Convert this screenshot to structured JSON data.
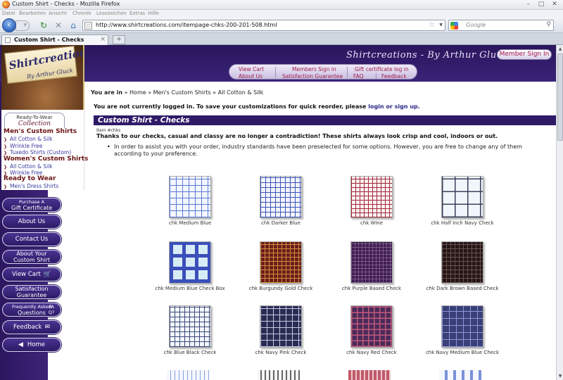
{
  "window": {
    "title": "Custom Shirt - Checks - Mozilla Firefox",
    "controls": [
      "–",
      "□",
      "✕"
    ]
  },
  "menubar": [
    "Datei",
    "Bearbeiten",
    "Ansicht",
    "Chronik",
    "Lesezeichen",
    "Extras",
    "Hilfe"
  ],
  "navbar": {
    "url": "http://www.shirtcreations.com/itempage-chks-200-201-508.html",
    "search_placeholder": "Google"
  },
  "tab": {
    "title": "Custom Shirt - Checks"
  },
  "header": {
    "brand": "Shirtcreations - By Arthur Gluck",
    "signin": "Member Sign In",
    "logo_main": "Shirtcreations",
    "logo_sub": "By Arthur Gluck"
  },
  "topmenu": {
    "row1": [
      "View Cart",
      "Members Sign in",
      "Gift certificate log in"
    ],
    "row2": [
      "About Us",
      "Satisfaction Guarantee",
      "FAQ",
      "Feedback"
    ]
  },
  "sidebar": {
    "rtw_line1": "Ready-To-Wear",
    "rtw_line2": "Collection",
    "sections": [
      {
        "heading": "Men's Custom Shirts",
        "links": [
          "All Cotton & Silk",
          "Wrinkle Free",
          "Tuxedo Shirts (Custom)"
        ]
      },
      {
        "heading": "Women's Custom Shirts",
        "links": [
          "All Cotton & Silk",
          "Wrinkle Free"
        ]
      },
      {
        "heading": "Ready to Wear",
        "links": [
          "Men's Dress Shirts"
        ]
      }
    ],
    "buttons": [
      {
        "l1": "Purchase A",
        "l2": "Gift Certificate"
      },
      {
        "label": "About Us"
      },
      {
        "label": "Contact Us"
      },
      {
        "l1": "About Your",
        "l2": "Custom Shirt"
      },
      {
        "label": "View Cart"
      },
      {
        "l1": "Satisfaction",
        "l2": "Guarantee"
      },
      {
        "l1": "Frequently Asked",
        "l2": "Questions"
      },
      {
        "label": "Feedback"
      },
      {
        "label": "Home"
      }
    ],
    "faq_badge": "FA Q?"
  },
  "breadcrumb": {
    "you": "You are in",
    "sep": "»",
    "items": [
      "Home",
      "Men's Custom Shirts",
      "All Cotton & Silk"
    ]
  },
  "login_msg": {
    "text": "You are not currently logged in. To save your customizations for quick reorder, please",
    "link": "login or sign up."
  },
  "page": {
    "title": "Custom Shirt - Checks",
    "item_no": "Item #chks",
    "intro": "Thanks to our checks, casual and classy are no longer a contradiction! These shirts always look crisp and cool, indoors or out.",
    "note": "In order to assist you with your order, industry standards have been preselected for some options. However, you are free to change any of them according to your preference."
  },
  "products": [
    {
      "name": "chk Medium Blue",
      "base": "#f4f7ff",
      "line": "#5a78d8",
      "grid": 9,
      "width": 1
    },
    {
      "name": "chk Darker Blue",
      "base": "#f2f4fb",
      "line": "#3b55b8",
      "grid": 7,
      "width": 1
    },
    {
      "name": "chk Wine",
      "base": "#fbf2f2",
      "line": "#a2283a",
      "grid": 6,
      "width": 1
    },
    {
      "name": "chk Half Inch Navy Check",
      "base": "#f0f6fb",
      "line": "#3a4058",
      "grid": 18,
      "width": 1.5
    },
    {
      "name": "chk Medium Blue Check Box",
      "base": "#d8ecf6",
      "line": "#3b4fba",
      "grid": 18,
      "width": 5
    },
    {
      "name": "chk Burgundy Gold Check",
      "base": "#6d1c1c",
      "line": "#c8923a",
      "grid": 6,
      "width": 0.8
    },
    {
      "name": "chk Purple Based Check",
      "base": "#3f1d4f",
      "line": "#7a5a8a",
      "grid": 5,
      "width": 0.8
    },
    {
      "name": "chk Dark Brown Based Check",
      "base": "#241616",
      "line": "#6a5050",
      "grid": 6,
      "width": 0.8
    },
    {
      "name": "chk Blue Black Check",
      "base": "#f3f6fb",
      "line": "#3a4a7a",
      "grid": 7,
      "width": 1
    },
    {
      "name": "chk Navy Pink Check",
      "base": "#292c52",
      "line": "#c6c8e0",
      "grid": 9,
      "width": 1
    },
    {
      "name": "chk Navy Red Check",
      "base": "#4a2a5a",
      "line": "#c05a7a",
      "grid": 8,
      "width": 1.5
    },
    {
      "name": "chk Navy Medium Blue Check",
      "base": "#3a3f78",
      "line": "#8f96d8",
      "grid": 10,
      "width": 1.2
    }
  ]
}
